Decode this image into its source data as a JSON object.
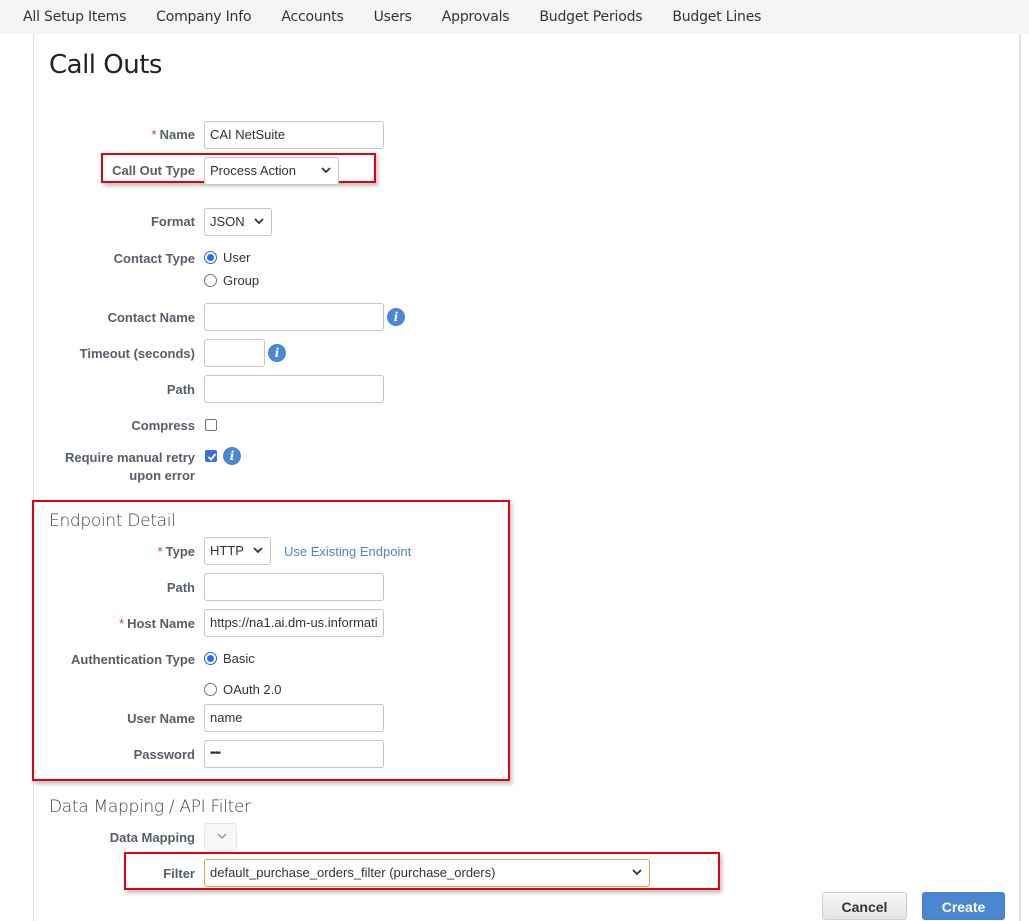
{
  "nav": {
    "items": [
      "All Setup Items",
      "Company Info",
      "Accounts",
      "Users",
      "Approvals",
      "Budget Periods",
      "Budget Lines"
    ]
  },
  "page": {
    "title": "Call Outs"
  },
  "form": {
    "name": {
      "label": "Name",
      "required": "*",
      "value": "CAI NetSuite"
    },
    "call_out_type": {
      "label": "Call Out Type",
      "value": "Process Action"
    },
    "format": {
      "label": "Format",
      "value": "JSON"
    },
    "contact_type": {
      "label": "Contact Type",
      "options": [
        "User",
        "Group"
      ],
      "selected": "User"
    },
    "contact_name": {
      "label": "Contact Name",
      "value": ""
    },
    "timeout": {
      "label": "Timeout (seconds)",
      "value": ""
    },
    "path": {
      "label": "Path",
      "value": ""
    },
    "compress": {
      "label": "Compress",
      "checked": false
    },
    "manual_retry": {
      "label_line1": "Require manual retry",
      "label_line2": "upon error",
      "checked": true
    }
  },
  "endpoint": {
    "title": "Endpoint Detail",
    "type": {
      "label": "Type",
      "required": "*",
      "value": "HTTP"
    },
    "use_existing_link": "Use Existing Endpoint",
    "path": {
      "label": "Path",
      "value": ""
    },
    "host_name": {
      "label": "Host Name",
      "required": "*",
      "value": "https://na1.ai.dm-us.informati"
    },
    "auth_type": {
      "label": "Authentication Type",
      "options": [
        "Basic",
        "OAuth 2.0"
      ],
      "selected": "Basic"
    },
    "user_name": {
      "label": "User Name",
      "value": "name"
    },
    "password": {
      "label": "Password",
      "value": "••••"
    }
  },
  "mapping": {
    "title": "Data Mapping / API Filter",
    "data_mapping": {
      "label": "Data Mapping",
      "value": ""
    },
    "filter": {
      "label": "Filter",
      "value": "default_purchase_orders_filter (purchase_orders)"
    }
  },
  "actions": {
    "cancel": "Cancel",
    "create": "Create"
  },
  "icons": {
    "info": "i"
  },
  "colors": {
    "highlight": "#e3000f",
    "accent": "#4a87d0",
    "required": "#d9342b",
    "filter_focus": "#e8a33d"
  }
}
